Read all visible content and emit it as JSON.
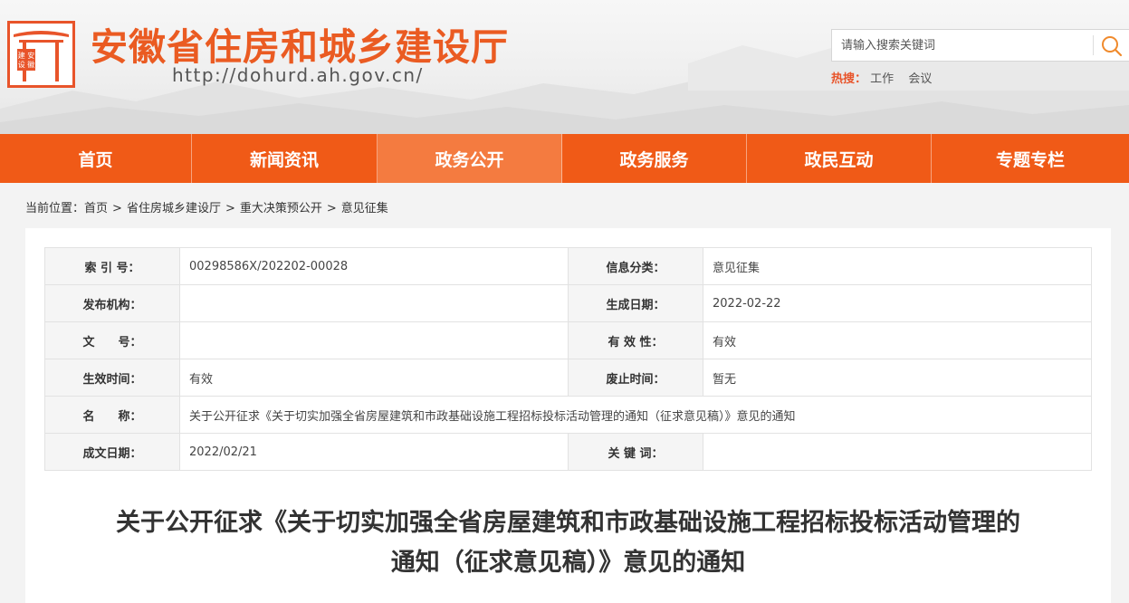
{
  "header": {
    "logo_text": "建 安\n设 徽",
    "site_title": "安徽省住房和城乡建设厅",
    "site_url": "http://dohurd.ah.gov.cn/",
    "search": {
      "placeholder": "请输入搜索关键词",
      "value": ""
    },
    "hot": {
      "label": "热搜：",
      "items": [
        "工作",
        "会议"
      ]
    }
  },
  "nav": {
    "items": [
      {
        "label": "首页",
        "active": false
      },
      {
        "label": "新闻资讯",
        "active": false
      },
      {
        "label": "政务公开",
        "active": true
      },
      {
        "label": "政务服务",
        "active": false
      },
      {
        "label": "政民互动",
        "active": false
      },
      {
        "label": "专题专栏",
        "active": false
      }
    ]
  },
  "breadcrumb": {
    "prefix": "当前位置：",
    "items": [
      "首页",
      "省住房城乡建设厅",
      "重大决策预公开",
      "意见征集"
    ],
    "separator": ">"
  },
  "meta": {
    "rows": [
      {
        "l1": "索 引 号：",
        "v1": "00298586X/202202-00028",
        "l2": "信息分类：",
        "v2": "意见征集"
      },
      {
        "l1": "发布机构：",
        "v1": "",
        "l2": "生成日期：",
        "v2": "2022-02-22"
      },
      {
        "l1": "文　　号：",
        "v1": "",
        "l2": "有 效 性：",
        "v2": "有效"
      },
      {
        "l1": "生效时间：",
        "v1": "有效",
        "l2": "废止时间：",
        "v2": "暂无"
      },
      {
        "l1": "名　　称：",
        "v1": "关于公开征求《关于切实加强全省房屋建筑和市政基础设施工程招标投标活动管理的通知（征求意见稿）》意见的通知"
      },
      {
        "l1": "成文日期：",
        "v1": "2022/02/21",
        "l2": "关 键 词：",
        "v2": ""
      }
    ]
  },
  "article": {
    "title_line1": "关于公开征求《关于切实加强全省房屋建筑和市政基础设施工程招标投标活动管理的",
    "title_line2": "通知（征求意见稿）》意见的通知"
  },
  "colors": {
    "brand": "#f05a17",
    "nav_active": "#f47b40",
    "title": "#ea5b22"
  },
  "icons": {
    "logo": "gate-logo-icon",
    "search": "search-icon"
  }
}
